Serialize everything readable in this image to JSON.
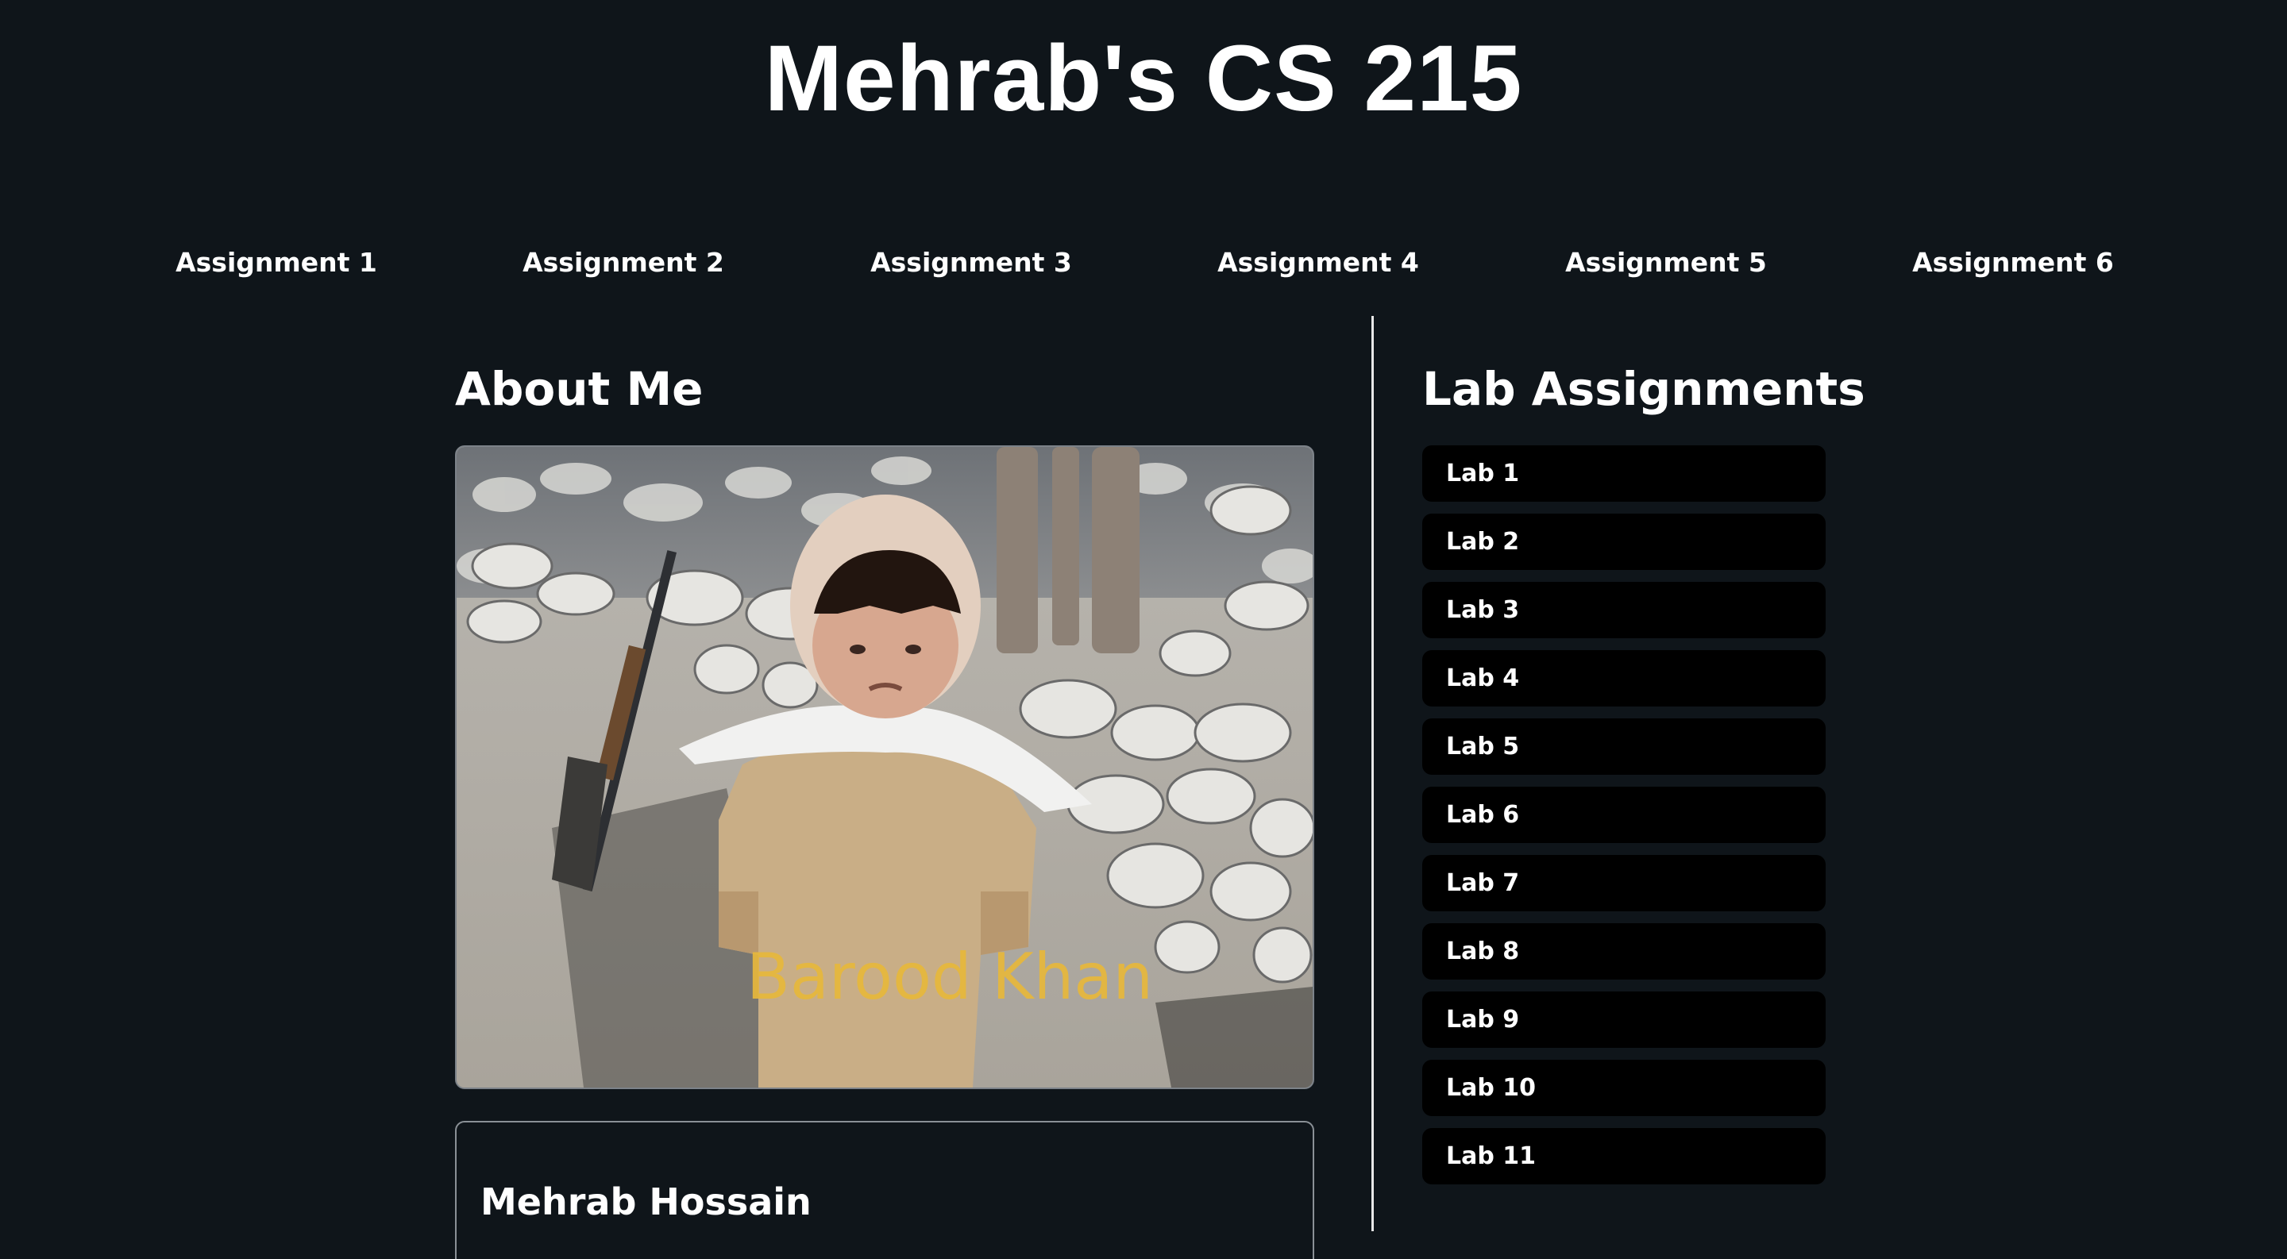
{
  "header": {
    "title": "Mehrab's CS 215"
  },
  "nav": {
    "items": [
      {
        "label": "Assignment 1"
      },
      {
        "label": "Assignment 2"
      },
      {
        "label": "Assignment 3"
      },
      {
        "label": "Assignment 4"
      },
      {
        "label": "Assignment 5"
      },
      {
        "label": "Assignment 6"
      }
    ]
  },
  "about": {
    "heading": "About Me",
    "photo_caption": "Barood Khan",
    "name": "Mehrab Hossain"
  },
  "labs": {
    "heading": "Lab Assignments",
    "items": [
      {
        "label": "Lab 1"
      },
      {
        "label": "Lab 2"
      },
      {
        "label": "Lab 3"
      },
      {
        "label": "Lab 4"
      },
      {
        "label": "Lab 5"
      },
      {
        "label": "Lab 6"
      },
      {
        "label": "Lab 7"
      },
      {
        "label": "Lab 8"
      },
      {
        "label": "Lab 9"
      },
      {
        "label": "Lab 10"
      },
      {
        "label": "Lab 11"
      }
    ]
  },
  "colors": {
    "background": "#0f151a",
    "text": "#ffffff",
    "lab_button": "#000000",
    "caption": "#e7b83c"
  }
}
